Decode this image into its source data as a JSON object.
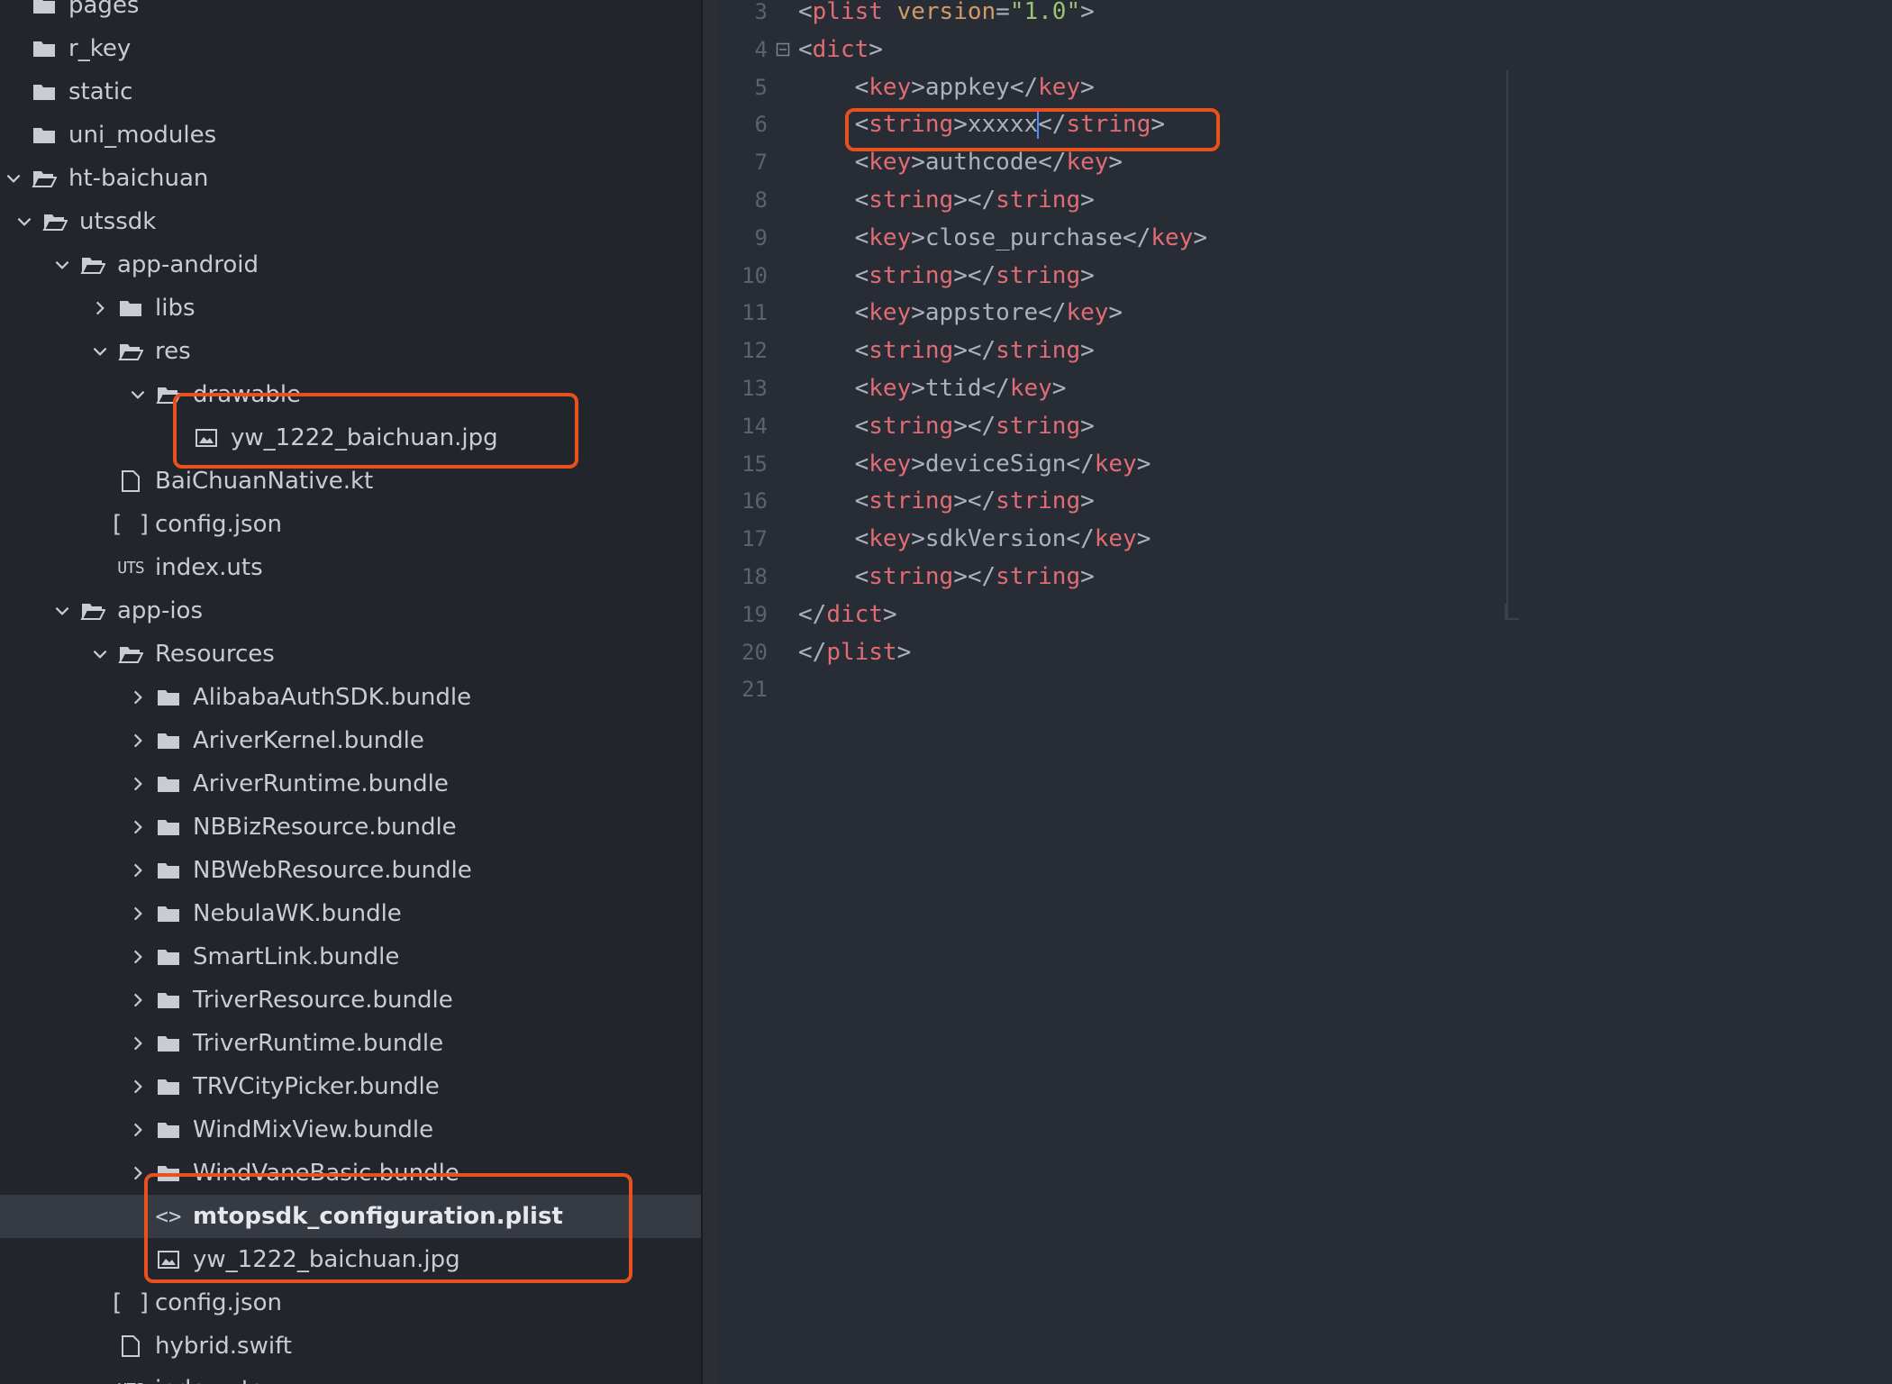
{
  "sidebar": {
    "items": [
      {
        "label": "pages",
        "chevron": "none",
        "icon": "folder-icon"
      },
      {
        "label": "r_key",
        "chevron": "none",
        "icon": "folder-icon"
      },
      {
        "label": "static",
        "chevron": "none",
        "icon": "folder-icon"
      },
      {
        "label": "uni_modules",
        "chevron": "none",
        "icon": "folder-icon"
      },
      {
        "label": "ht-baichuan",
        "chevron": "down",
        "icon": "folder-open-icon"
      },
      {
        "label": "utssdk",
        "chevron": "down",
        "icon": "folder-open-icon"
      },
      {
        "label": "app-android",
        "chevron": "down",
        "icon": "folder-open-icon"
      },
      {
        "label": "libs",
        "chevron": "right",
        "icon": "folder-icon"
      },
      {
        "label": "res",
        "chevron": "down",
        "icon": "folder-open-icon"
      },
      {
        "label": "drawable",
        "chevron": "down",
        "icon": "folder-open-icon"
      },
      {
        "label": "yw_1222_baichuan.jpg",
        "chevron": "none",
        "icon": "image-file-icon"
      },
      {
        "label": "BaiChuanNative.kt",
        "chevron": "none",
        "icon": "file-icon"
      },
      {
        "label": "config.json",
        "chevron": "none",
        "icon": "json-file-icon",
        "glyph": "[ ]"
      },
      {
        "label": "index.uts",
        "chevron": "none",
        "icon": "uts-file-icon",
        "glyph": "UTS"
      },
      {
        "label": "app-ios",
        "chevron": "down",
        "icon": "folder-open-icon"
      },
      {
        "label": "Resources",
        "chevron": "down",
        "icon": "folder-open-icon"
      },
      {
        "label": "AlibabaAuthSDK.bundle",
        "chevron": "right",
        "icon": "folder-icon"
      },
      {
        "label": "AriverKernel.bundle",
        "chevron": "right",
        "icon": "folder-icon"
      },
      {
        "label": "AriverRuntime.bundle",
        "chevron": "right",
        "icon": "folder-icon"
      },
      {
        "label": "NBBizResource.bundle",
        "chevron": "right",
        "icon": "folder-icon"
      },
      {
        "label": "NBWebResource.bundle",
        "chevron": "right",
        "icon": "folder-icon"
      },
      {
        "label": "NebulaWK.bundle",
        "chevron": "right",
        "icon": "folder-icon"
      },
      {
        "label": "SmartLink.bundle",
        "chevron": "right",
        "icon": "folder-icon"
      },
      {
        "label": "TriverResource.bundle",
        "chevron": "right",
        "icon": "folder-icon"
      },
      {
        "label": "TriverRuntime.bundle",
        "chevron": "right",
        "icon": "folder-icon"
      },
      {
        "label": "TRVCityPicker.bundle",
        "chevron": "right",
        "icon": "folder-icon"
      },
      {
        "label": "WindMixView.bundle",
        "chevron": "right",
        "icon": "folder-icon"
      },
      {
        "label": "WindVaneBasic.bundle",
        "chevron": "right",
        "icon": "folder-icon"
      },
      {
        "label": "mtopsdk_configuration.plist",
        "chevron": "none",
        "icon": "code-file-icon",
        "glyph": "<>",
        "selected": true
      },
      {
        "label": "yw_1222_baichuan.jpg",
        "chevron": "none",
        "icon": "image-file-icon"
      },
      {
        "label": "config.json",
        "chevron": "none",
        "icon": "json-file-icon",
        "glyph": "[ ]"
      },
      {
        "label": "hybrid.swift",
        "chevron": "none",
        "icon": "file-icon"
      },
      {
        "label": "index.uts",
        "chevron": "none",
        "icon": "uts-file-icon",
        "glyph": "UTS"
      }
    ]
  },
  "editor": {
    "lines": [
      {
        "n": "3",
        "fold": "",
        "tokens": [
          [
            "punc",
            "<"
          ],
          [
            "tag",
            "plist"
          ],
          [
            "punc",
            " "
          ],
          [
            "attr",
            "version"
          ],
          [
            "punc",
            "="
          ],
          [
            "strv",
            "\"1.0\""
          ],
          [
            "punc",
            ">"
          ]
        ]
      },
      {
        "n": "4",
        "fold": "open",
        "tokens": [
          [
            "punc",
            "<"
          ],
          [
            "tag",
            "dict"
          ],
          [
            "punc",
            ">"
          ]
        ]
      },
      {
        "n": "5",
        "fold": "",
        "tokens": [
          [
            "punc",
            "    <"
          ],
          [
            "tag",
            "key"
          ],
          [
            "punc",
            ">appkey</"
          ],
          [
            "tag",
            "key"
          ],
          [
            "punc",
            ">"
          ]
        ]
      },
      {
        "n": "6",
        "fold": "",
        "tokens": [
          [
            "punc",
            "    <"
          ],
          [
            "tag",
            "string"
          ],
          [
            "punc",
            ">xxxxx"
          ],
          [
            "cursor",
            ""
          ],
          [
            "punc",
            "</"
          ],
          [
            "tag",
            "string"
          ],
          [
            "punc",
            ">"
          ]
        ]
      },
      {
        "n": "7",
        "fold": "",
        "tokens": [
          [
            "punc",
            "    <"
          ],
          [
            "tag",
            "key"
          ],
          [
            "punc",
            ">authcode</"
          ],
          [
            "tag",
            "key"
          ],
          [
            "punc",
            ">"
          ]
        ]
      },
      {
        "n": "8",
        "fold": "",
        "tokens": [
          [
            "punc",
            "    <"
          ],
          [
            "tag",
            "string"
          ],
          [
            "punc",
            "></"
          ],
          [
            "tag",
            "string"
          ],
          [
            "punc",
            ">"
          ]
        ]
      },
      {
        "n": "9",
        "fold": "",
        "tokens": [
          [
            "punc",
            "    <"
          ],
          [
            "tag",
            "key"
          ],
          [
            "punc",
            ">close_purchase</"
          ],
          [
            "tag",
            "key"
          ],
          [
            "punc",
            ">"
          ]
        ]
      },
      {
        "n": "10",
        "fold": "",
        "tokens": [
          [
            "punc",
            "    <"
          ],
          [
            "tag",
            "string"
          ],
          [
            "punc",
            "></"
          ],
          [
            "tag",
            "string"
          ],
          [
            "punc",
            ">"
          ]
        ]
      },
      {
        "n": "11",
        "fold": "",
        "tokens": [
          [
            "punc",
            "    <"
          ],
          [
            "tag",
            "key"
          ],
          [
            "punc",
            ">appstore</"
          ],
          [
            "tag",
            "key"
          ],
          [
            "punc",
            ">"
          ]
        ]
      },
      {
        "n": "12",
        "fold": "",
        "tokens": [
          [
            "punc",
            "    <"
          ],
          [
            "tag",
            "string"
          ],
          [
            "punc",
            "></"
          ],
          [
            "tag",
            "string"
          ],
          [
            "punc",
            ">"
          ]
        ]
      },
      {
        "n": "13",
        "fold": "",
        "tokens": [
          [
            "punc",
            "    <"
          ],
          [
            "tag",
            "key"
          ],
          [
            "punc",
            ">ttid</"
          ],
          [
            "tag",
            "key"
          ],
          [
            "punc",
            ">"
          ]
        ]
      },
      {
        "n": "14",
        "fold": "",
        "tokens": [
          [
            "punc",
            "    <"
          ],
          [
            "tag",
            "string"
          ],
          [
            "punc",
            "></"
          ],
          [
            "tag",
            "string"
          ],
          [
            "punc",
            ">"
          ]
        ]
      },
      {
        "n": "15",
        "fold": "",
        "tokens": [
          [
            "punc",
            "    <"
          ],
          [
            "tag",
            "key"
          ],
          [
            "punc",
            ">deviceSign</"
          ],
          [
            "tag",
            "key"
          ],
          [
            "punc",
            ">"
          ]
        ]
      },
      {
        "n": "16",
        "fold": "",
        "tokens": [
          [
            "punc",
            "    <"
          ],
          [
            "tag",
            "string"
          ],
          [
            "punc",
            "></"
          ],
          [
            "tag",
            "string"
          ],
          [
            "punc",
            ">"
          ]
        ]
      },
      {
        "n": "17",
        "fold": "",
        "tokens": [
          [
            "punc",
            "    <"
          ],
          [
            "tag",
            "key"
          ],
          [
            "punc",
            ">sdkVersion</"
          ],
          [
            "tag",
            "key"
          ],
          [
            "punc",
            ">"
          ]
        ]
      },
      {
        "n": "18",
        "fold": "",
        "tokens": [
          [
            "punc",
            "    <"
          ],
          [
            "tag",
            "string"
          ],
          [
            "punc",
            "></"
          ],
          [
            "tag",
            "string"
          ],
          [
            "punc",
            ">"
          ]
        ]
      },
      {
        "n": "19",
        "fold": "",
        "tokens": [
          [
            "punc",
            "</"
          ],
          [
            "tag",
            "dict"
          ],
          [
            "punc",
            ">"
          ]
        ]
      },
      {
        "n": "20",
        "fold": "",
        "tokens": [
          [
            "punc",
            "</"
          ],
          [
            "tag",
            "plist"
          ],
          [
            "punc",
            ">"
          ]
        ]
      },
      {
        "n": "21",
        "fold": "",
        "tokens": []
      }
    ]
  },
  "colors": {
    "highlight_box": "#e8501e",
    "tag": "#e06c75",
    "attribute": "#d19a66",
    "string_value": "#98c379",
    "cursor": "#528bff"
  }
}
